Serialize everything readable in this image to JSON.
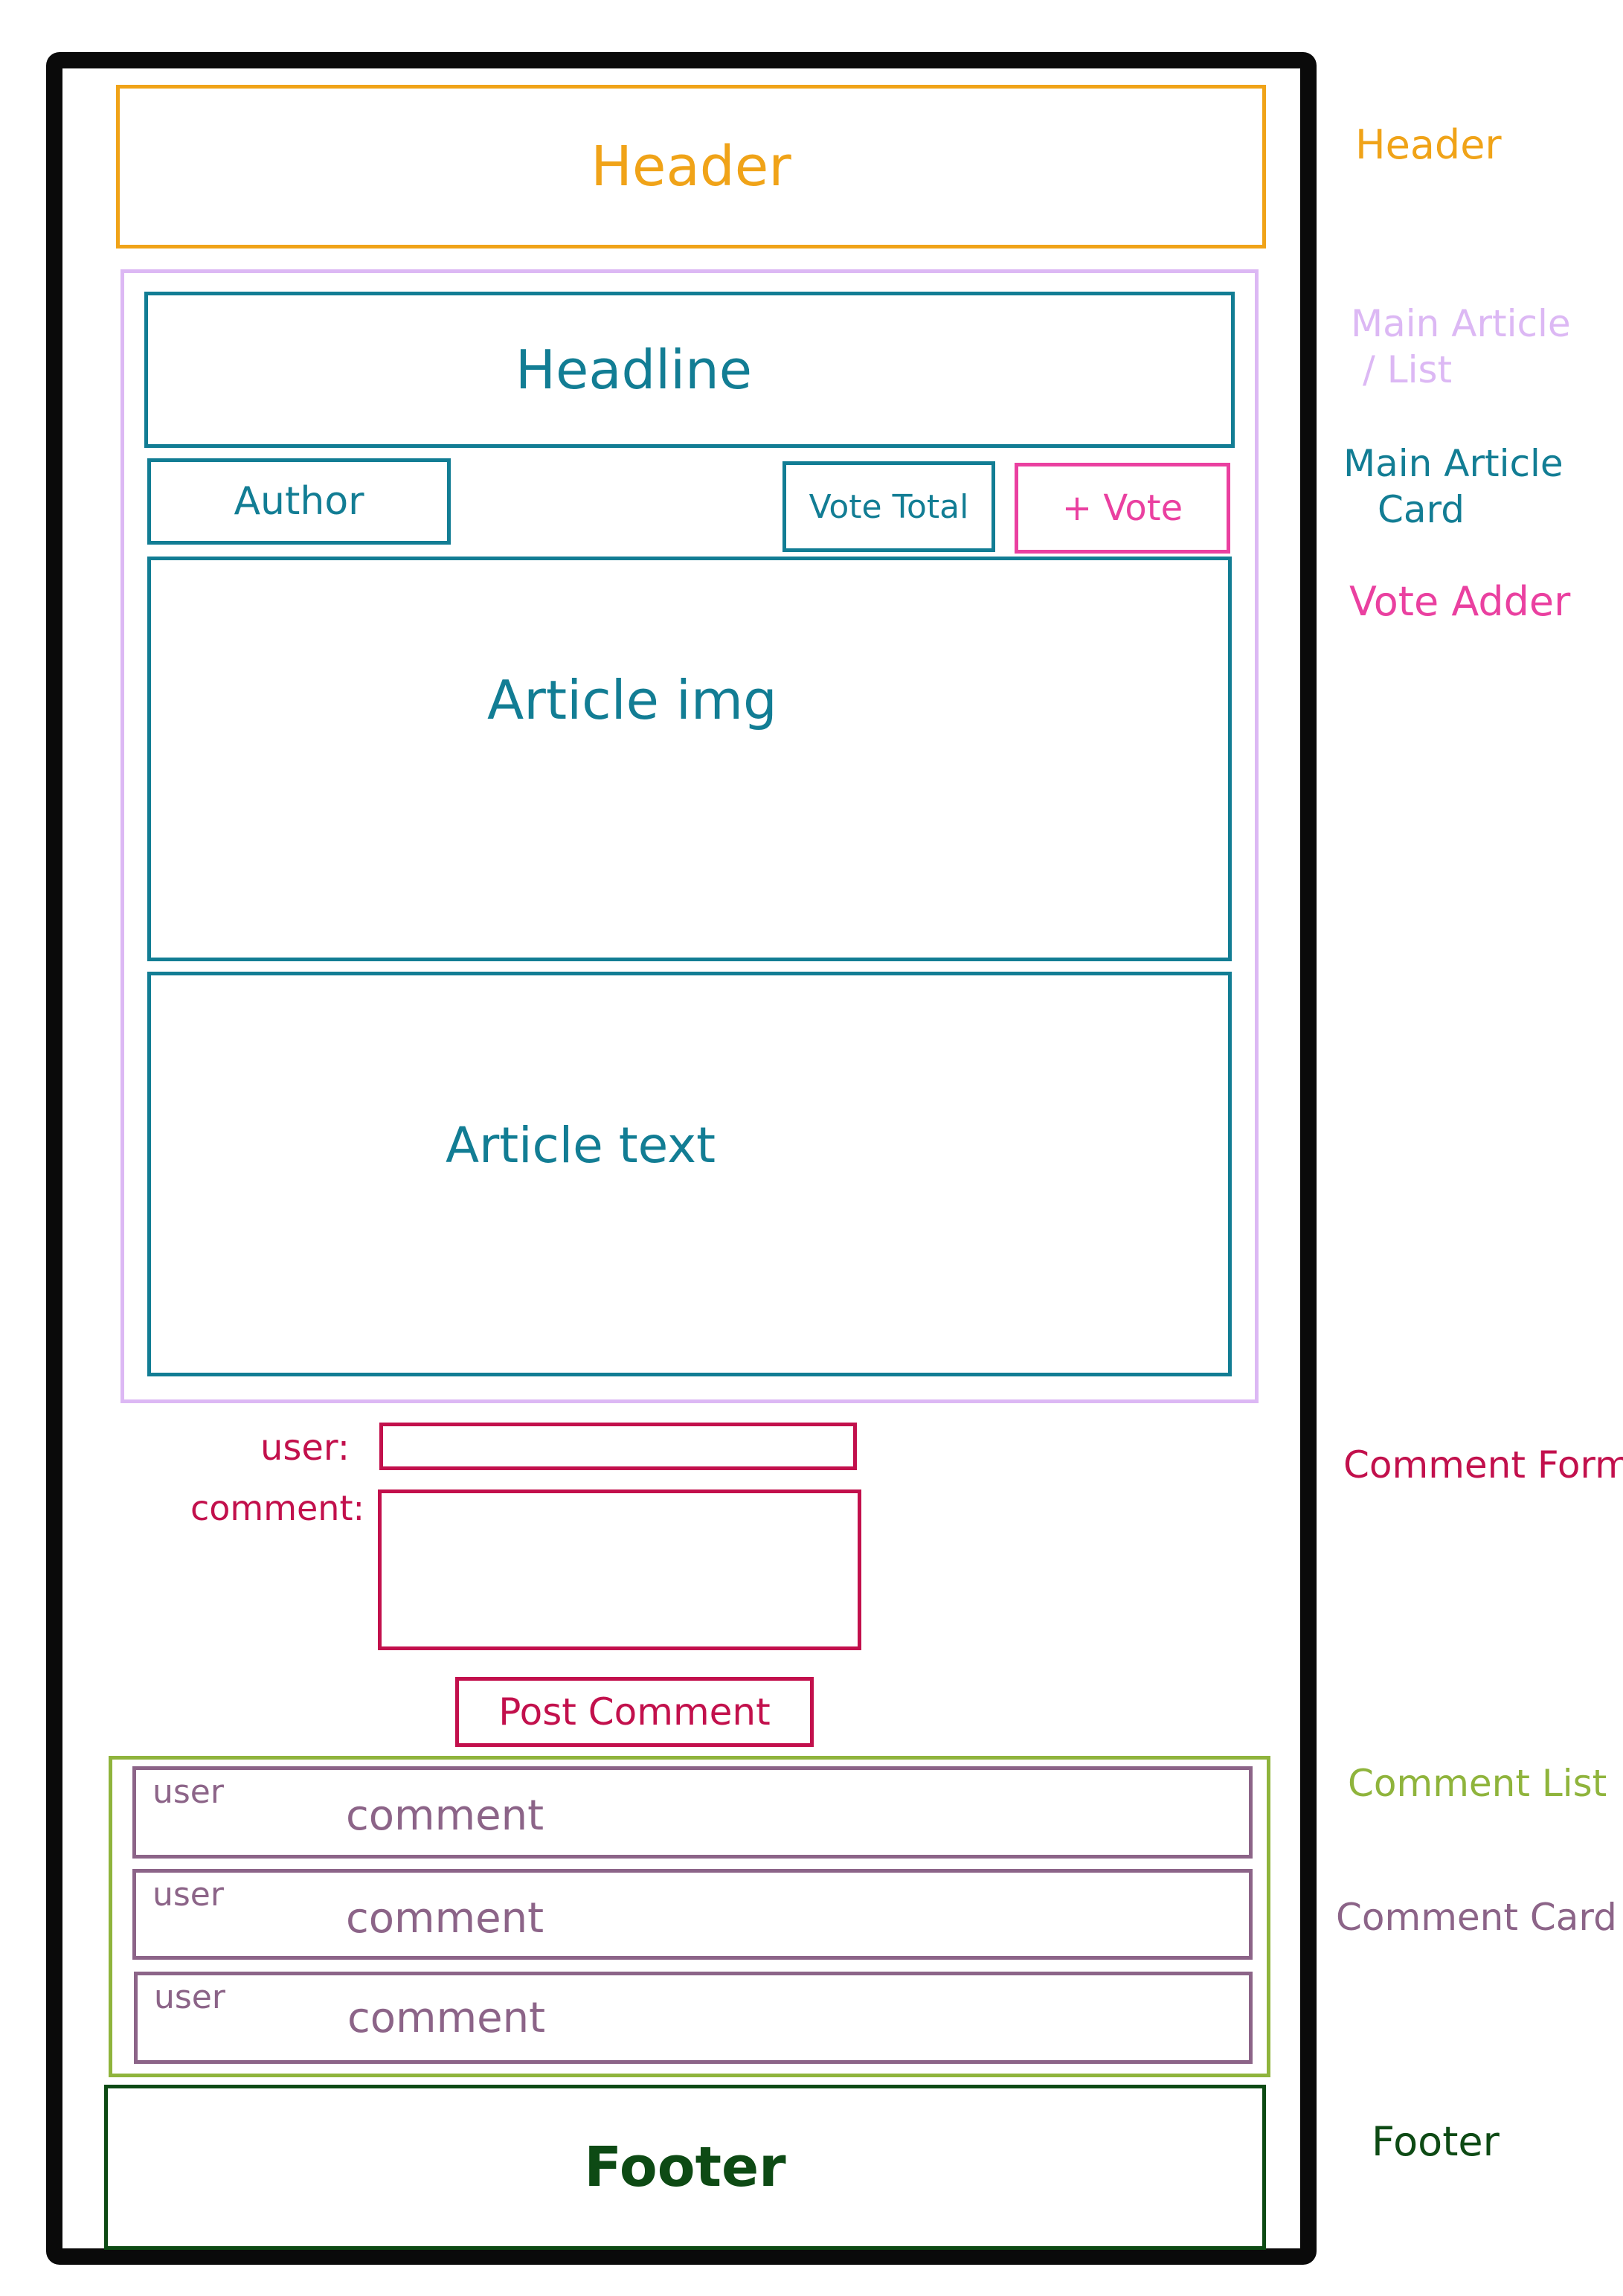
{
  "colors": {
    "header": "#f0a318",
    "main_article_list": "#dcb8f4",
    "main_article_card": "#127d94",
    "vote_adder": "#ea40a0",
    "comment_form": "#c2104c",
    "comment_list": "#8fb43c",
    "comment_card": "#8c6488",
    "footer": "#0d4a14",
    "frame": "#0a0a0a"
  },
  "wireframe": {
    "header": "Header",
    "headline": "Headline",
    "author": "Author",
    "vote_total": "Vote Total",
    "vote_button": "+ Vote",
    "article_img": "Article img",
    "article_text": "Article text",
    "comment_form": {
      "user_label": "user:",
      "comment_label": "comment:",
      "user_value": "",
      "comment_value": "",
      "submit": "Post Comment"
    },
    "comments": [
      {
        "user": "user",
        "comment": "comment"
      },
      {
        "user": "user",
        "comment": "comment"
      },
      {
        "user": "user",
        "comment": "comment"
      }
    ],
    "footer": "Footer"
  },
  "legend": {
    "header": "Header",
    "main_article_list_line1": "Main Article",
    "main_article_list_line2": "/ List",
    "main_article_card_line1": "Main Article",
    "main_article_card_line2": "Card",
    "vote_adder": "Vote Adder",
    "comment_form": "Comment Form",
    "comment_list": "Comment List",
    "comment_card": "Comment Card",
    "footer": "Footer"
  }
}
